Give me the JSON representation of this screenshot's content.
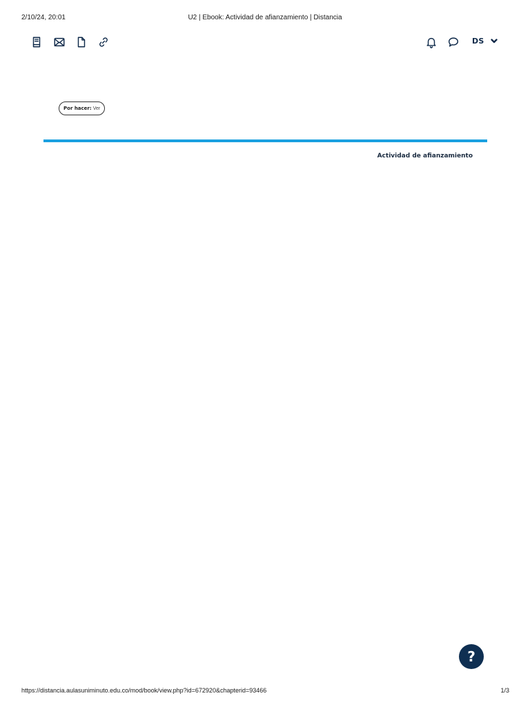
{
  "print_header": {
    "date": "2/10/24, 20:01",
    "title": "U2 | Ebook: Actividad de afianzamiento | Distancia"
  },
  "toolbar": {
    "left_icons": [
      "book-icon",
      "mail-icon",
      "file-icon",
      "link-icon"
    ],
    "right_icons": [
      "bell-icon",
      "chat-icon"
    ],
    "user_initials": "DS",
    "menu_icon": "chevron-down-icon"
  },
  "todo": {
    "label": "Por hacer:",
    "value": "Ver"
  },
  "chapter": {
    "title": "Actividad de afianzamiento"
  },
  "help": {
    "label": "?"
  },
  "print_footer": {
    "url": "https://distancia.aulasuniminuto.edu.co/mod/book/view.php?id=672920&chapterid=93466",
    "page": "1/3"
  },
  "colors": {
    "accent": "#1aa0e0",
    "brand_dark": "#0f2f52"
  }
}
